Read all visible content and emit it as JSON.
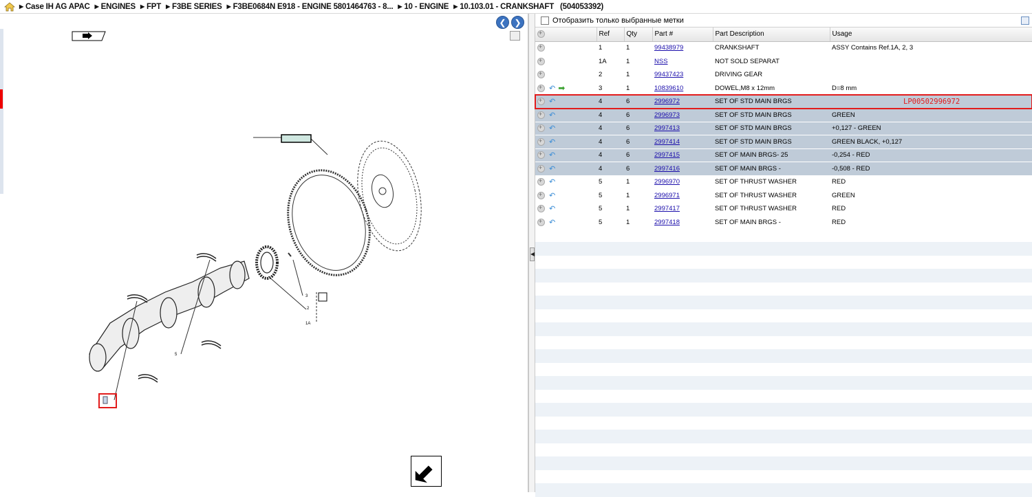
{
  "breadcrumb": {
    "items": [
      "Case IH AG APAC",
      "ENGINES",
      "FPT",
      "F3BE SERIES",
      "F3BE0684N E918 - ENGINE 5801464763 - 8...",
      "10 - ENGINE",
      "10.103.01 - CRANKSHAFT"
    ],
    "id": "(504053392)"
  },
  "filter": {
    "label": "Отобразить только выбранные метки"
  },
  "table": {
    "headers": {
      "ref": "Ref",
      "qty": "Qty",
      "part": "Part #",
      "desc": "Part Description",
      "usage": "Usage"
    },
    "rows": [
      {
        "ref": "1",
        "qty": "1",
        "part": "99438979",
        "desc": "CRANKSHAFT",
        "usage": "ASSY Contains Ref.1A, 2, 3",
        "back": false,
        "fwd": false,
        "state": "plain"
      },
      {
        "ref": "1A",
        "qty": "1",
        "part": "NSS",
        "desc": "NOT SOLD SEPARAT",
        "usage": "",
        "back": false,
        "fwd": false,
        "state": "plain"
      },
      {
        "ref": "2",
        "qty": "1",
        "part": "99437423",
        "desc": "DRIVING GEAR",
        "usage": "",
        "back": false,
        "fwd": false,
        "state": "plain"
      },
      {
        "ref": "3",
        "qty": "1",
        "part": "10839610",
        "desc": "DOWEL,M8 x 12mm",
        "usage": "D=8 mm",
        "back": true,
        "fwd": true,
        "state": "plain"
      },
      {
        "ref": "4",
        "qty": "6",
        "part": "2996972",
        "desc": "SET OF STD MAIN BRGS",
        "usage": "",
        "back": true,
        "fwd": false,
        "state": "highlighted",
        "annotation": "LP00502996972"
      },
      {
        "ref": "4",
        "qty": "6",
        "part": "2996973",
        "desc": "SET OF STD MAIN BRGS",
        "usage": "GREEN",
        "back": true,
        "fwd": false,
        "state": "selected"
      },
      {
        "ref": "4",
        "qty": "6",
        "part": "2997413",
        "desc": "SET OF STD MAIN BRGS",
        "usage": "+0,127 - GREEN",
        "back": true,
        "fwd": false,
        "state": "selected"
      },
      {
        "ref": "4",
        "qty": "6",
        "part": "2997414",
        "desc": "SET OF STD MAIN BRGS",
        "usage": "GREEN BLACK, +0,127",
        "back": true,
        "fwd": false,
        "state": "selected"
      },
      {
        "ref": "4",
        "qty": "6",
        "part": "2997415",
        "desc": "SET OF MAIN BRGS- 25",
        "usage": "-0,254 - RED",
        "back": true,
        "fwd": false,
        "state": "selected"
      },
      {
        "ref": "4",
        "qty": "6",
        "part": "2997416",
        "desc": "SET OF MAIN BRGS   -",
        "usage": "-0,508 - RED",
        "back": true,
        "fwd": false,
        "state": "selected"
      },
      {
        "ref": "5",
        "qty": "1",
        "part": "2996970",
        "desc": "SET OF THRUST WASHER",
        "usage": "RED",
        "back": true,
        "fwd": false,
        "state": "plain"
      },
      {
        "ref": "5",
        "qty": "1",
        "part": "2996971",
        "desc": "SET OF THRUST WASHER",
        "usage": "GREEN",
        "back": true,
        "fwd": false,
        "state": "plain"
      },
      {
        "ref": "5",
        "qty": "1",
        "part": "2997417",
        "desc": "SET OF THRUST WASHER",
        "usage": "RED",
        "back": true,
        "fwd": false,
        "state": "plain"
      },
      {
        "ref": "5",
        "qty": "1",
        "part": "2997418",
        "desc": "SET OF MAIN BRGS   -",
        "usage": "RED",
        "back": true,
        "fwd": false,
        "state": "plain"
      }
    ]
  },
  "icons": {
    "home": "home-icon",
    "nav_back": "arrow-left-icon",
    "nav_forward": "arrow-right-icon",
    "row_expand": "plus-circle-icon",
    "row_back": "return-arrow-icon",
    "row_forward": "forward-arrow-icon"
  },
  "colors": {
    "selected_row": "#bfcbd8",
    "highlight_border": "#e21b1b",
    "annotation": "#e21b1b",
    "link": "#1a0dab",
    "nav_button": "#3c73c0"
  }
}
